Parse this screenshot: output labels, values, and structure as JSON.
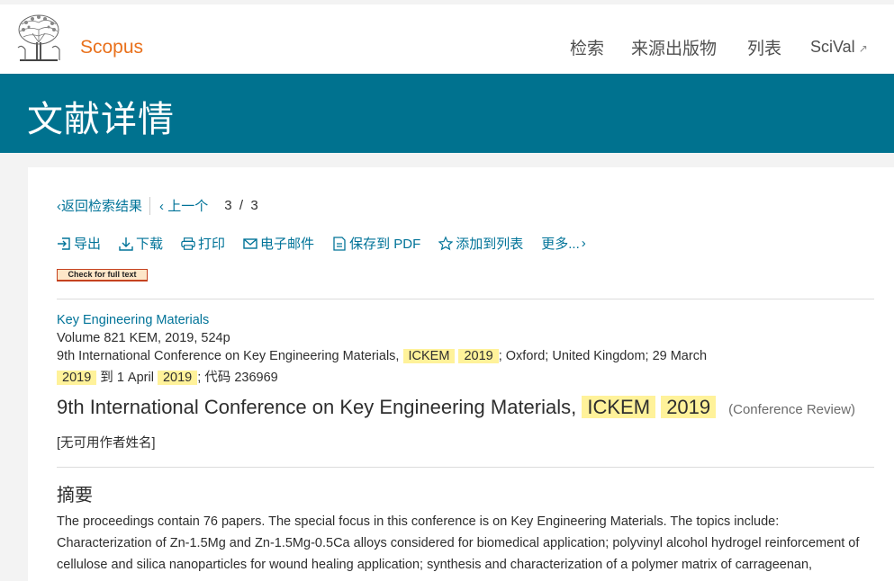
{
  "header": {
    "brand": "Scopus",
    "nav": [
      {
        "label": "检索"
      },
      {
        "label": "来源出版物"
      },
      {
        "label": "列表"
      },
      {
        "label": "SciVal",
        "external_icon": "external-link-icon"
      }
    ]
  },
  "banner": {
    "title": "文献详情"
  },
  "pager": {
    "back": "返回检索结果",
    "prev": "上一个",
    "current": "3",
    "divider": "/",
    "total": "3"
  },
  "toolbar": {
    "export": "导出",
    "download": "下载",
    "print": "打印",
    "email": "电子邮件",
    "save_pdf": "保存到 PDF",
    "add_list": "添加到列表",
    "more": "更多..."
  },
  "fulltext": {
    "label": "Check for full text"
  },
  "doc": {
    "source": "Key Engineering Materials",
    "volume": "Volume 821 KEM, 2019, 524p",
    "conf_prefix": "9th International Conference on Key Engineering Materials,",
    "conf_hl1": "ICKEM",
    "conf_hl2": "2019",
    "conf_mid": "; Oxford; United Kingdom; 29 March",
    "conf_hl3": "2019",
    "conf_to": "到 1 April",
    "conf_hl4": "2019",
    "conf_code": "; 代码 236969",
    "title_prefix": "9th International Conference on Key Engineering Materials,",
    "title_hl1": "ICKEM",
    "title_hl2": "2019",
    "doc_type": "(Conference Review)",
    "authors": "[无可用作者姓名]"
  },
  "abstract": {
    "heading": "摘要",
    "text": "The proceedings contain 76 papers. The special focus in this conference is on Key Engineering Materials. The topics include: Characterization of Zn-1.5Mg and Zn-1.5Mg-0.5Ca alloys considered for biomedical application; polyvinyl alcohol hydrogel reinforcement of cellulose and silica nanoparticles for wound healing application; synthesis and characterization of a polymer matrix of carrageenan,"
  },
  "colors": {
    "accent": "#e9711c",
    "banner": "#00728f",
    "link": "#007398",
    "highlight": "#fff29a"
  }
}
